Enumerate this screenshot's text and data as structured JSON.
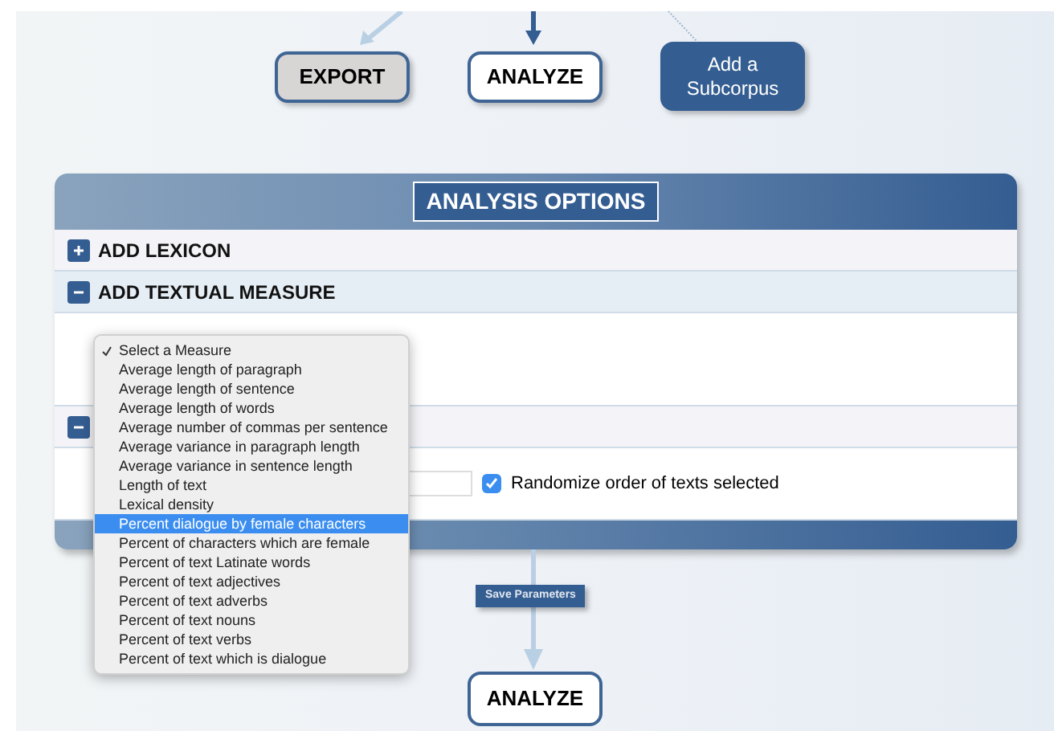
{
  "flow_top": {
    "buttons": [
      {
        "label": "EXPORT",
        "kind": "grey"
      },
      {
        "label": "ANALYZE",
        "kind": "white"
      },
      {
        "label": "Add a Subcorpus",
        "kind": "blue"
      }
    ]
  },
  "panel": {
    "title": "ANALYSIS OPTIONS",
    "sections": [
      {
        "title": "ADD LEXICON",
        "expanded": false
      },
      {
        "title": "ADD TEXTUAL MEASURE",
        "expanded": true
      },
      {
        "expanded": true,
        "randomize": {
          "label": "Randomize order of texts selected",
          "checked": true
        }
      }
    ]
  },
  "measure_menu": {
    "options": [
      {
        "label": "Select a Measure",
        "checked": true,
        "selected": false
      },
      {
        "label": "Average length of paragraph",
        "checked": false,
        "selected": false
      },
      {
        "label": "Average length of sentence",
        "checked": false,
        "selected": false
      },
      {
        "label": "Average length of words",
        "checked": false,
        "selected": false
      },
      {
        "label": "Average number of commas per sentence",
        "checked": false,
        "selected": false
      },
      {
        "label": "Average variance in paragraph length",
        "checked": false,
        "selected": false
      },
      {
        "label": "Average variance in sentence length",
        "checked": false,
        "selected": false
      },
      {
        "label": "Length of text",
        "checked": false,
        "selected": false
      },
      {
        "label": "Lexical density",
        "checked": false,
        "selected": false
      },
      {
        "label": "Percent dialogue by female characters",
        "checked": false,
        "selected": true
      },
      {
        "label": "Percent of characters which are female",
        "checked": false,
        "selected": false
      },
      {
        "label": "Percent of text Latinate words",
        "checked": false,
        "selected": false
      },
      {
        "label": "Percent of text adjectives",
        "checked": false,
        "selected": false
      },
      {
        "label": "Percent of text adverbs",
        "checked": false,
        "selected": false
      },
      {
        "label": "Percent of text nouns",
        "checked": false,
        "selected": false
      },
      {
        "label": "Percent of text verbs",
        "checked": false,
        "selected": false
      },
      {
        "label": "Percent of text which is dialogue",
        "checked": false,
        "selected": false
      }
    ]
  },
  "save_button": {
    "label": "Save Parameters"
  },
  "flow_bottom": {
    "button": {
      "label": "ANALYZE"
    }
  }
}
